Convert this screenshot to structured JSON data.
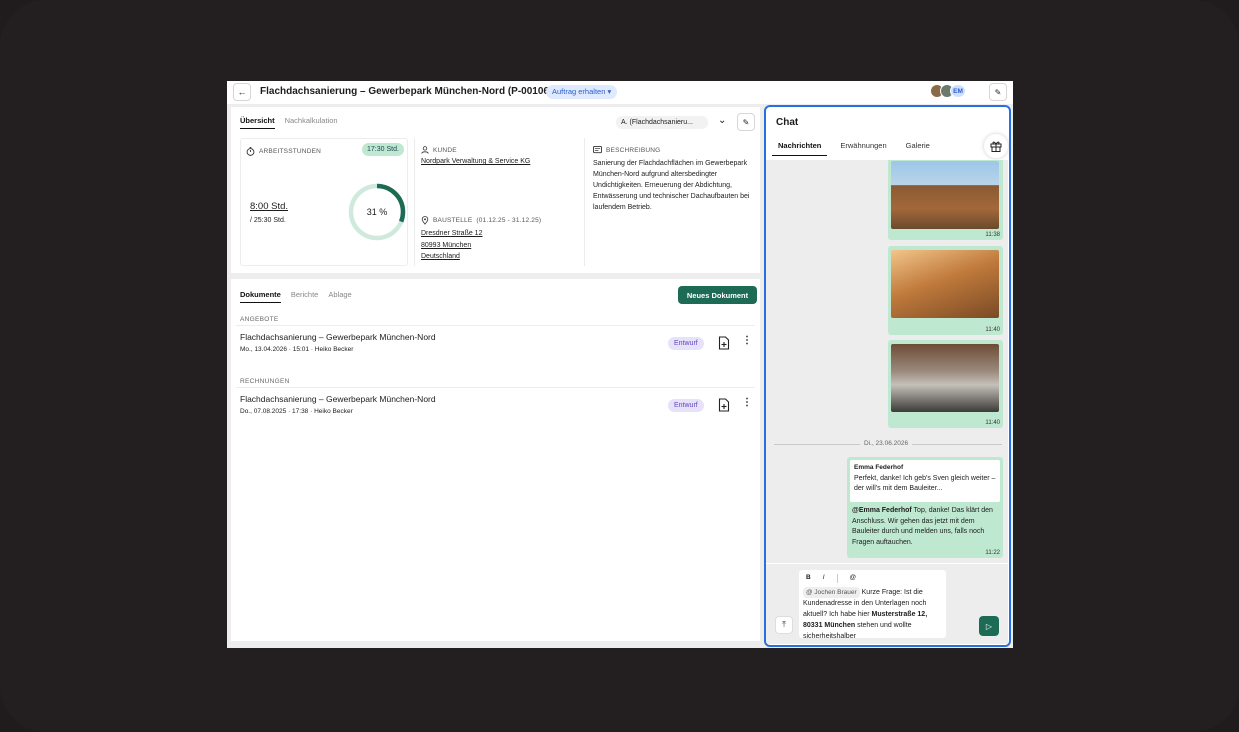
{
  "header": {
    "title": "Flachdachsanierung – Gewerbepark München-Nord (P-00106)",
    "status": "Auftrag erhalten",
    "avatar_initials": "EM"
  },
  "overview": {
    "tabs": [
      "Übersicht",
      "Nachkalkulation"
    ],
    "select_value": "A. (Flachdachsanieru...",
    "hours": {
      "label": "ARBEITSSTUNDEN",
      "badge": "17:30 Std.",
      "done": "8:00 Std.",
      "total": "/ 25:30 Std.",
      "percent_label": "31 %",
      "percent": 31
    },
    "customer": {
      "label": "KUNDE",
      "name": "Nordpark Verwaltung & Service KG"
    },
    "site": {
      "label": "BAUSTELLE",
      "dates": "(01.12.25 - 31.12.25)",
      "street": "Dresdner Straße 12",
      "city": "80993 München",
      "country": "Deutschland"
    },
    "description": {
      "label": "BESCHREIBUNG",
      "text": "Sanierung der Flachdachflächen im Gewerbepark München-Nord aufgrund altersbedingter Undichtigkeiten. Erneuerung der Abdichtung, Entwässerung und technischer Dachaufbauten bei laufendem Betrieb."
    }
  },
  "documents": {
    "tabs": [
      "Dokumente",
      "Berichte",
      "Ablage"
    ],
    "new_button": "Neues Dokument",
    "sections": [
      {
        "title": "ANGEBOTE",
        "rows": [
          {
            "title": "Flachdachsanierung – Gewerbepark München-Nord",
            "meta": "Mo., 13.04.2026 · 15:01 · Heiko Becker",
            "status": "Entwurf"
          }
        ]
      },
      {
        "title": "RECHNUNGEN",
        "rows": [
          {
            "title": "Flachdachsanierung – Gewerbepark München-Nord",
            "meta": "Do., 07.08.2025 · 17:38 · Heiko Becker",
            "status": "Entwurf"
          }
        ]
      }
    ]
  },
  "chat": {
    "title": "Chat",
    "tabs": [
      "Nachrichten",
      "Erwähnungen",
      "Galerie"
    ],
    "image_messages": [
      {
        "time": "11:38"
      },
      {
        "time": "11:40"
      },
      {
        "time": "11:40"
      }
    ],
    "date_separator": "Di., 23.06.2026",
    "text_message": {
      "quote_author": "Emma Federhof",
      "quote_text": "Perfekt, danke! Ich geb's Sven gleich weiter – der will's mit dem Bauleiter...",
      "mention": "@Emma Federhof",
      "text": " Top, danke! Das klärt den Anschluss. Wir gehen das jetzt mit dem Bauleiter durch und melden uns, falls noch Fragen auftauchen.",
      "time": "11:22"
    },
    "composer": {
      "toolbar": [
        "B",
        "I",
        "@"
      ],
      "mention": "@ Jochen Brauer",
      "text_a": " Kurze Frage: Ist die Kundenadresse in den Unterlagen noch aktuell? Ich habe hier ",
      "bold": "Musterstraße 12, 80331 München",
      "text_b": " stehen und wollte sicherheitshalber"
    }
  }
}
